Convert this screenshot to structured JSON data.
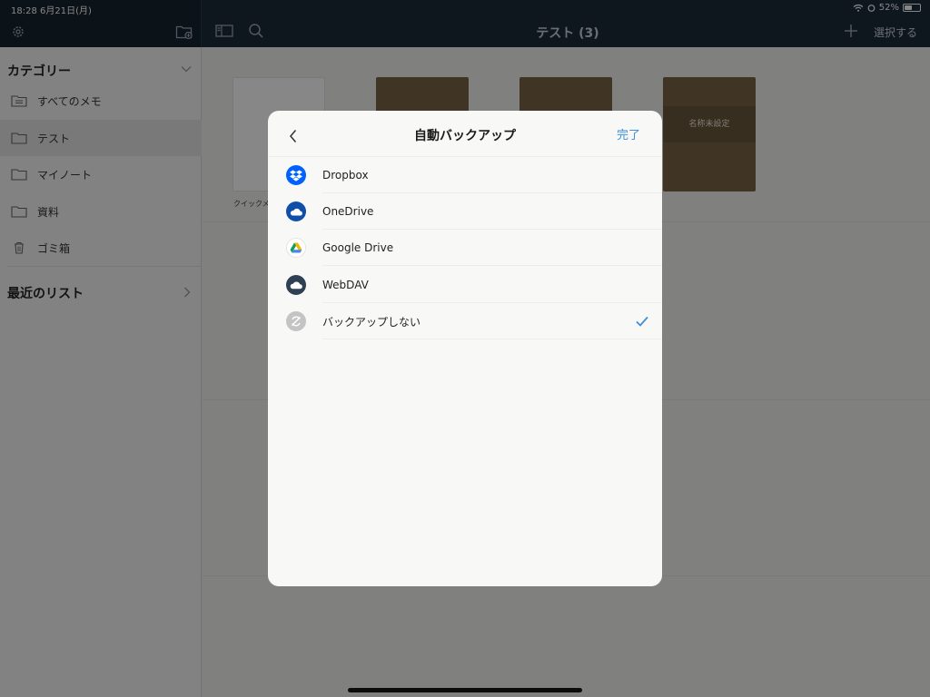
{
  "status_bar": {
    "time_date": "18:28 6月21日(月)",
    "battery_percent": "52%",
    "battery_level": 0.52
  },
  "nav": {
    "title": "テスト (3)",
    "select_label": "選択する"
  },
  "sidebar": {
    "categories_heading": "カテゴリー",
    "items": [
      {
        "label": "すべてのメモ",
        "icon": "all-notes-icon"
      },
      {
        "label": "テスト",
        "icon": "folder-icon"
      },
      {
        "label": "マイノート",
        "icon": "folder-icon"
      },
      {
        "label": "資料",
        "icon": "folder-icon"
      },
      {
        "label": "ゴミ箱",
        "icon": "trash-icon"
      }
    ],
    "recent_heading": "最近のリスト"
  },
  "notes": {
    "first_caption": "クイックメ",
    "card4_label": "名称未設定"
  },
  "modal": {
    "title": "自動バックアップ",
    "done_label": "完了",
    "options": [
      {
        "name": "Dropbox",
        "icon": "dropbox-icon",
        "color": "#0061fe"
      },
      {
        "name": "OneDrive",
        "icon": "onedrive-icon",
        "color": "#0f4fa8"
      },
      {
        "name": "Google Drive",
        "icon": "google-drive-icon",
        "color": "#ffffff"
      },
      {
        "name": "WebDAV",
        "icon": "webdav-icon",
        "color": "#2f3f54"
      },
      {
        "name": "バックアップしない",
        "icon": "no-backup-icon",
        "color": "#c4c4c4",
        "selected": true
      }
    ],
    "check_color": "#3d8fd6"
  }
}
